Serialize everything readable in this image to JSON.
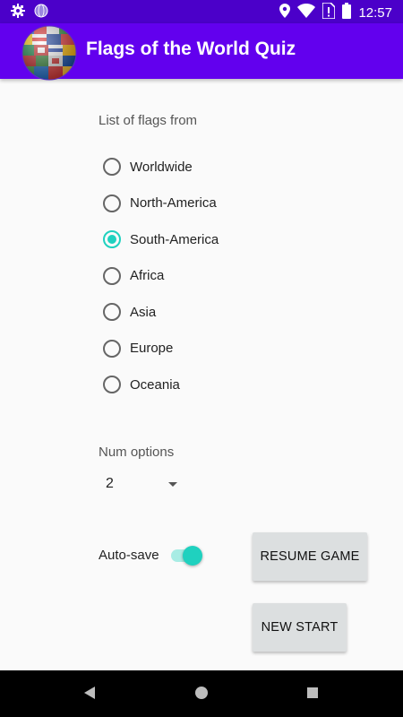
{
  "status_bar": {
    "time": "12:57",
    "icons": [
      "settings-icon",
      "globe-status-icon",
      "location-icon",
      "wifi-icon",
      "no-sim-icon",
      "battery-icon"
    ]
  },
  "app_bar": {
    "title": "Flags of the World Quiz",
    "logo_icon": "flag-globe-logo"
  },
  "flags_section": {
    "label": "List of flags from",
    "options": [
      {
        "label": "Worldwide",
        "checked": false
      },
      {
        "label": "North-America",
        "checked": false
      },
      {
        "label": "South-America",
        "checked": true
      },
      {
        "label": "Africa",
        "checked": false
      },
      {
        "label": "Asia",
        "checked": false
      },
      {
        "label": "Europe",
        "checked": false
      },
      {
        "label": "Oceania",
        "checked": false
      }
    ]
  },
  "num_options": {
    "label": "Num options",
    "value": "2"
  },
  "auto_save": {
    "label": "Auto-save",
    "enabled": true
  },
  "buttons": {
    "resume": "RESUME GAME",
    "new_start": "NEW START"
  },
  "colors": {
    "status_bar": "#4b00c9",
    "app_bar": "#6200ee",
    "accent": "#1fd1bf",
    "button": "#dcdfe0"
  }
}
